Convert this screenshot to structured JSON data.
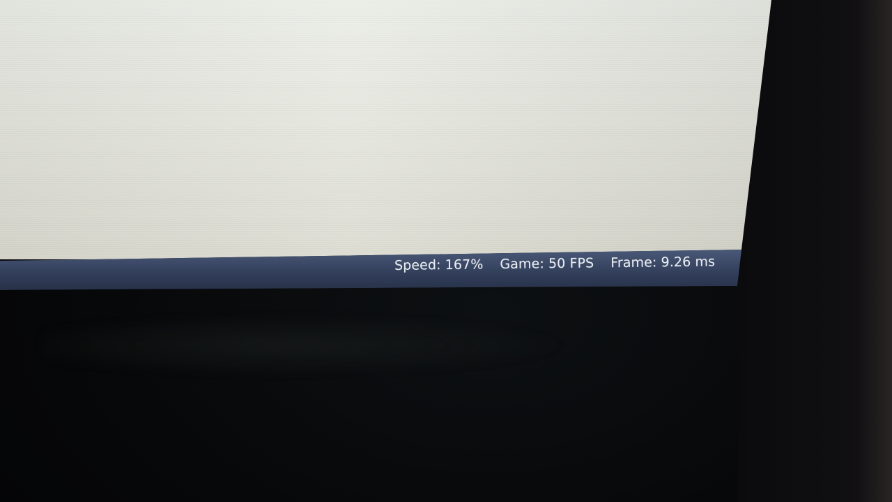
{
  "statusbar": {
    "speed": "Speed: 167%",
    "game": "Game: 50 FPS",
    "frame": "Frame: 9.26 ms"
  },
  "colors": {
    "window_bg": "#e6e7df",
    "statusbar_bg": "#34415d",
    "statusbar_text": "#e8ecf2",
    "background": "#050506"
  }
}
